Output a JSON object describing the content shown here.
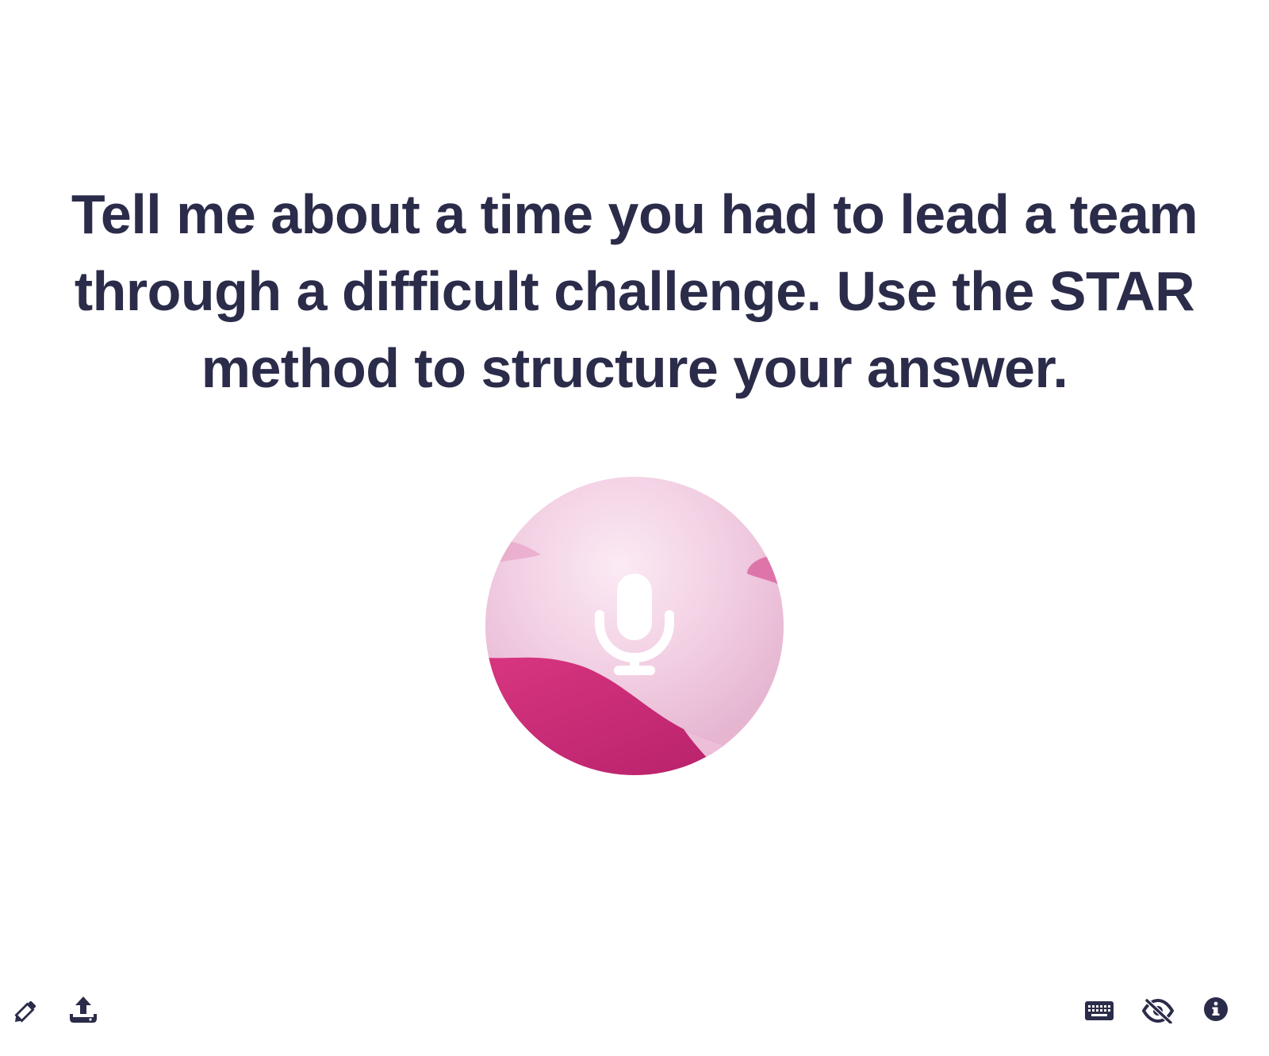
{
  "prompt": {
    "text": "Tell me about a time you had to lead a team through a difficult challenge. Use the STAR method to structure your answer."
  },
  "mic": {
    "icon": "microphone-icon"
  },
  "toolbar": {
    "left": [
      {
        "icon": "pencil-icon"
      },
      {
        "icon": "upload-icon"
      }
    ],
    "right": [
      {
        "icon": "keyboard-icon"
      },
      {
        "icon": "eye-slash-icon"
      },
      {
        "icon": "info-icon"
      }
    ]
  },
  "colors": {
    "text": "#2b2b4a",
    "icon": "#2b2b4a",
    "orb_light": "#f3d3e6",
    "orb_accent": "#c8286e"
  }
}
